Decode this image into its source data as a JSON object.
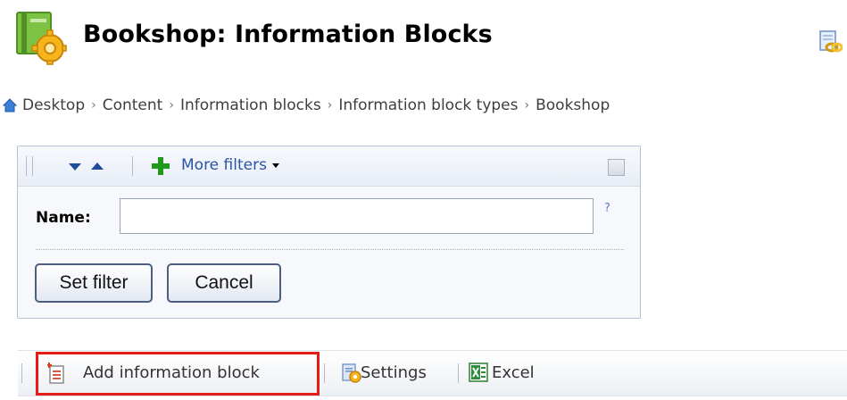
{
  "header": {
    "title": "Bookshop: Information Blocks",
    "icon": "information-block-settings-icon",
    "link_icon": "link-icon"
  },
  "breadcrumb": {
    "home_icon": "home-icon",
    "items": [
      "Desktop",
      "Content",
      "Information blocks",
      "Information block types",
      "Bookshop"
    ],
    "separator": "›"
  },
  "filter": {
    "more_filters_label": "More filters",
    "name_label": "Name:",
    "name_value": "",
    "help": "?",
    "set_filter_label": "Set filter",
    "cancel_label": "Cancel"
  },
  "toolbar": {
    "add_label": "Add information block",
    "settings_label": "Settings",
    "excel_label": "Excel"
  },
  "colors": {
    "link": "#2a55a3",
    "accent_green": "#1f9a18",
    "highlight": "#e41b17"
  }
}
